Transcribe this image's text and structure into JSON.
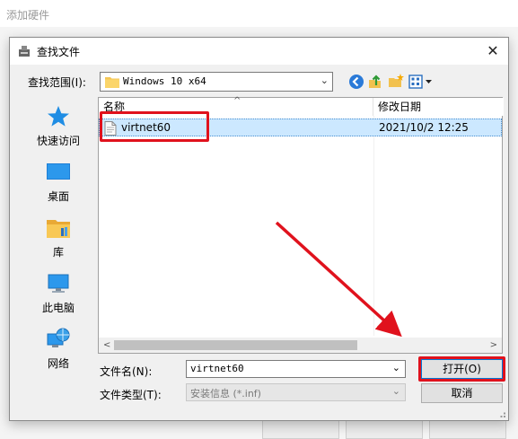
{
  "background_window": {
    "title": "添加硬件"
  },
  "dialog": {
    "title": "查找文件",
    "close_glyph": "✕",
    "look_in_label": "查找范围(I):",
    "look_in_value": "Windows 10 x64",
    "places": [
      {
        "label": "快速访问",
        "icon": "star-icon"
      },
      {
        "label": "桌面",
        "icon": "desktop-icon"
      },
      {
        "label": "库",
        "icon": "library-icon"
      },
      {
        "label": "此电脑",
        "icon": "computer-icon"
      },
      {
        "label": "网络",
        "icon": "network-icon"
      }
    ],
    "columns": {
      "name": "名称",
      "date": "修改日期"
    },
    "files": [
      {
        "name": "virtnet60",
        "date": "2021/10/2 12:25",
        "selected": true
      }
    ],
    "file_name_label": "文件名(N):",
    "file_name_value": "virtnet60",
    "file_type_label": "文件类型(T):",
    "file_type_value": "安装信息 (*.inf)",
    "open_button": "打开(O)",
    "cancel_button": "取消"
  },
  "colors": {
    "highlight": "#e0121d",
    "selection": "#cce8ff",
    "accent": "#0078d7"
  }
}
